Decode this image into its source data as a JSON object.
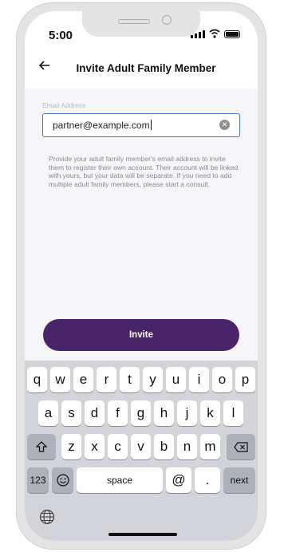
{
  "status": {
    "time": "5:00"
  },
  "header": {
    "title": "Invite Adult Family Member",
    "back_icon": "arrow-left-icon"
  },
  "form": {
    "label": "Email Address",
    "value": "partner@example.com",
    "help": "Provide your adult family member's email address to invite them to register their own account. Their account will be linked with yours, but your data will be separate. If you need to add multiple adult family members, please start a consult."
  },
  "button": {
    "label": "Invite",
    "color": "#4a2469"
  },
  "keyboard": {
    "row1": [
      "q",
      "w",
      "e",
      "r",
      "t",
      "y",
      "u",
      "i",
      "o",
      "p"
    ],
    "row2": [
      "a",
      "s",
      "d",
      "f",
      "g",
      "h",
      "j",
      "k",
      "l"
    ],
    "row3": [
      "z",
      "x",
      "c",
      "v",
      "b",
      "n",
      "m"
    ],
    "numbers": "123",
    "space": "space",
    "at": "@",
    "dot": ".",
    "next": "next"
  }
}
